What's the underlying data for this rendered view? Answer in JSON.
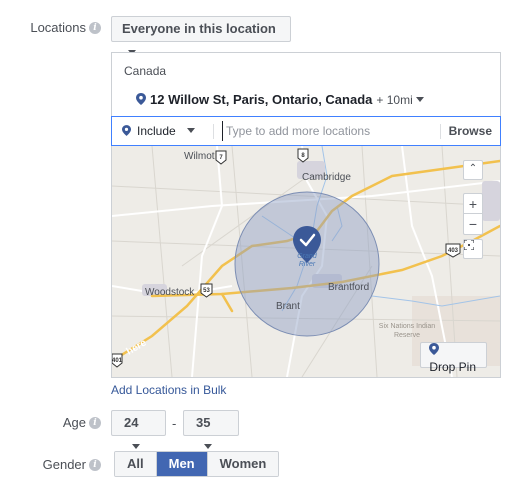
{
  "locations": {
    "label": "Locations",
    "audience_select": "Everyone in this location",
    "country": "Canada",
    "address": "12 Willow St, Paris, Ontario, Canada",
    "radius": "+ 10mi",
    "include_select": "Include",
    "search_placeholder": "Type to add more locations",
    "browse_label": "Browse",
    "map": {
      "cities": [
        "Cambridge",
        "Woodstock",
        "Brant",
        "Brantford",
        "Wilmot",
        "Grand River",
        "Six Nations Indian Reserve"
      ],
      "highway_shields": [
        "7",
        "8",
        "53",
        "403",
        "401"
      ],
      "zoom_in": "+",
      "zoom_out": "−",
      "drop_pin_label": "Drop Pin",
      "watermark": "here"
    },
    "bulk_link": "Add Locations in Bulk"
  },
  "age": {
    "label": "Age",
    "min": "24",
    "separator": "-",
    "max": "35"
  },
  "gender": {
    "label": "Gender",
    "options": [
      "All",
      "Men",
      "Women"
    ],
    "selected": "Men"
  },
  "colors": {
    "accent_blue": "#4267b2",
    "pin_blue": "#3b5998",
    "radius_fill": "#8b9dc3",
    "link_blue": "#365899"
  }
}
